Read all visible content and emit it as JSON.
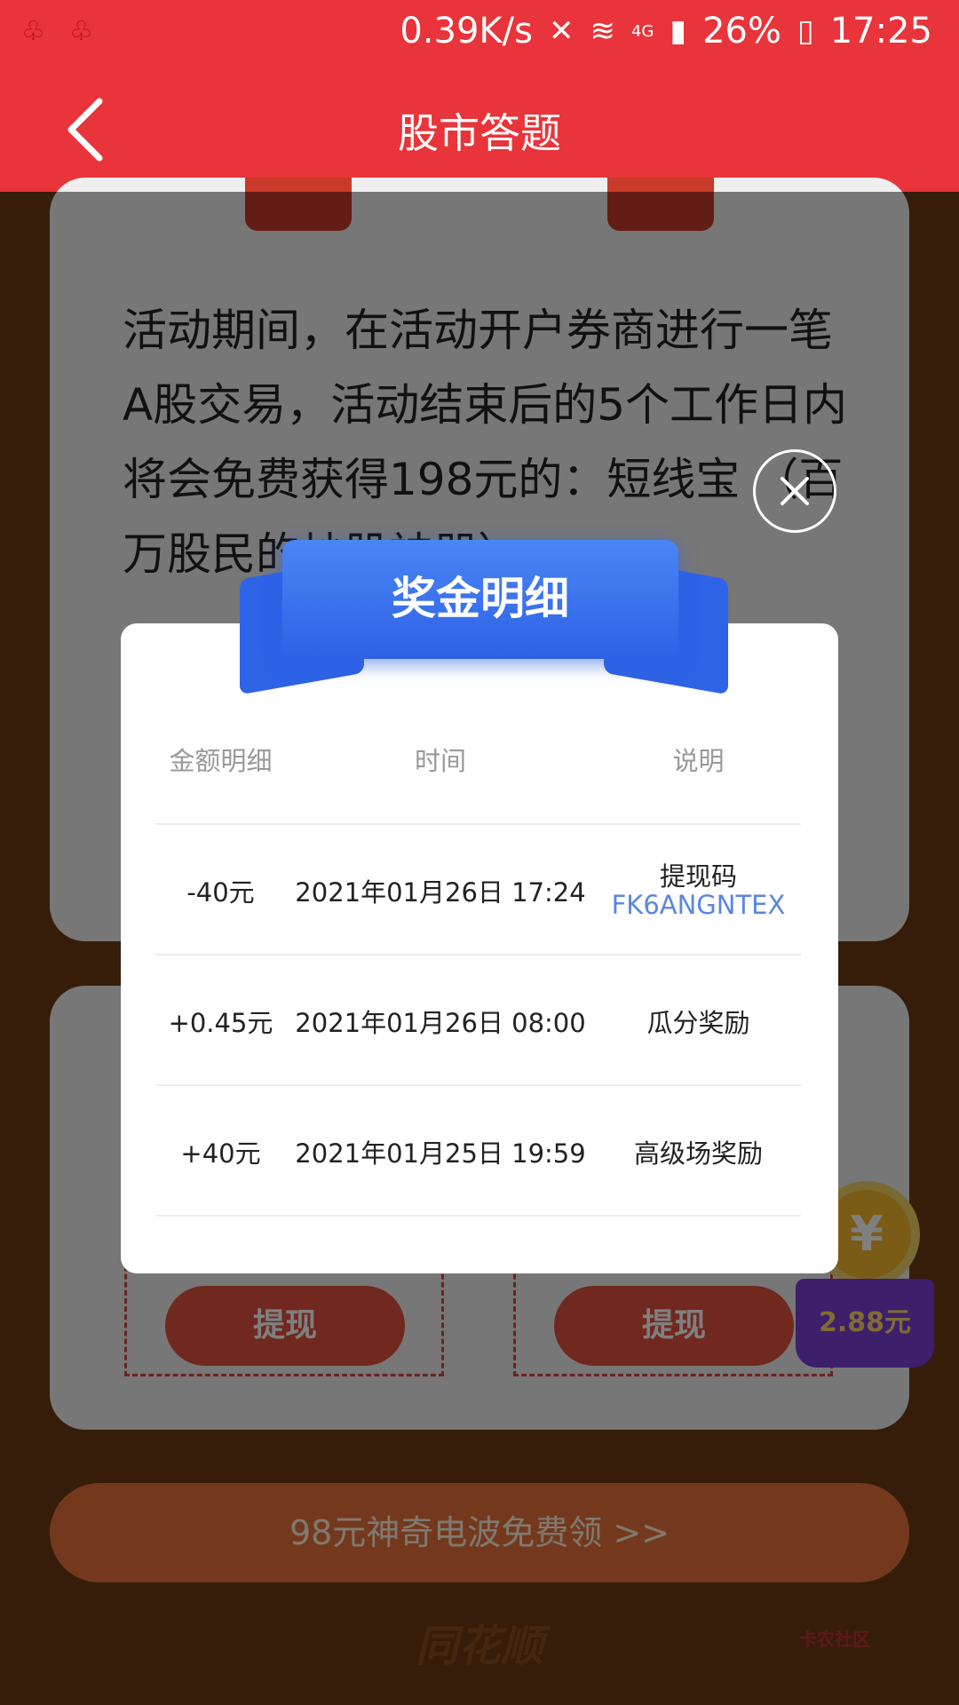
{
  "status_bar": {
    "speed": "0.39K/s",
    "network": "4G",
    "battery": "26%",
    "time": "17:25"
  },
  "header": {
    "title": "股市答题"
  },
  "background": {
    "activity_text": "活动期间，在活动开户券商进行一笔A股交易，活动结束后的5个工作日内将会免费获得198元的：短线宝 （百万股民的炒股神器）",
    "withdraw_left": "提现",
    "withdraw_right": "提现",
    "coin_symbol": "¥",
    "coin_amount": "2.88元",
    "promo": "98元神奇电波免费领 >>",
    "brand": "同花顺",
    "watermark": "卡农社区"
  },
  "modal": {
    "title": "奖金明细",
    "columns": [
      "金额明细",
      "时间",
      "说明"
    ],
    "rows": [
      {
        "amount": "-40元",
        "time": "2021年01月26日 17:24",
        "desc": "提现码",
        "code": "FK6ANGNTEX"
      },
      {
        "amount": "+0.45元",
        "time": "2021年01月26日 08:00",
        "desc": "瓜分奖励",
        "code": ""
      },
      {
        "amount": "+40元",
        "time": "2021年01月25日 19:59",
        "desc": "高级场奖励",
        "code": ""
      }
    ]
  },
  "colors": {
    "primary_red": "#e8343a",
    "modal_blue": "#2f63e6",
    "code_blue": "#5a86e0"
  }
}
